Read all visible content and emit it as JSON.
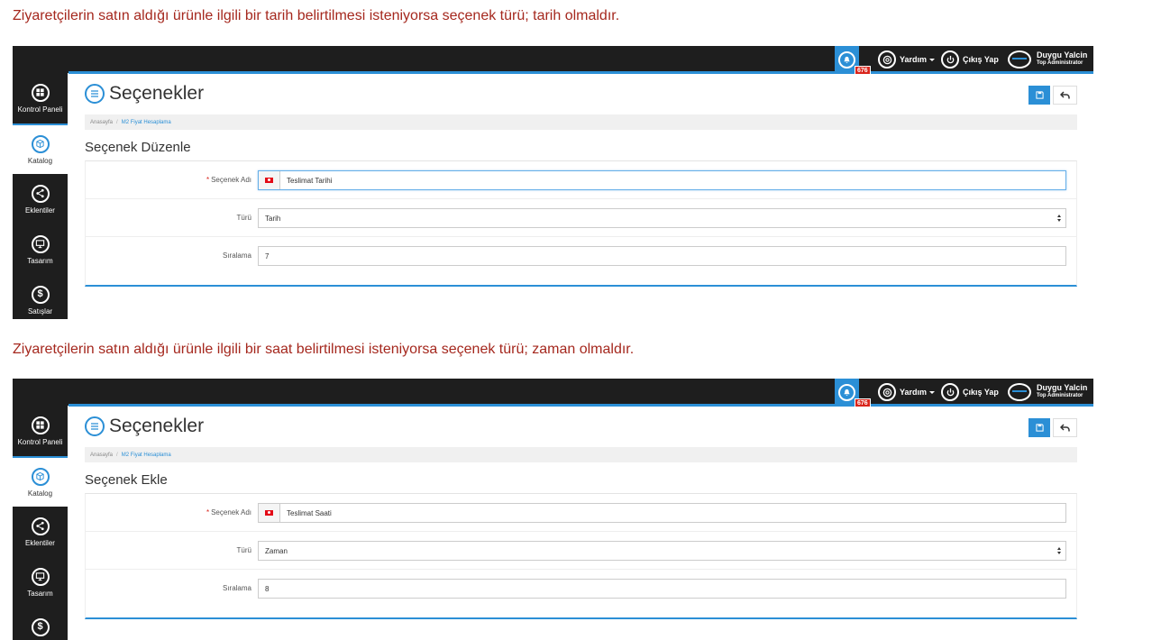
{
  "captions": [
    "Ziyaretçilerin satın aldığı ürünle ilgili bir tarih belirtilmesi isteniyorsa seçenek türü; tarih olmaldır.",
    "Ziyaretçilerin satın aldığı ürünle ilgili bir saat belirtilmesi isteniyorsa seçenek türü; zaman olmaldır."
  ],
  "topbar": {
    "notification_count": "676",
    "help_label": "Yardım",
    "logout_label": "Çıkış Yap",
    "user_name": "Duygu Yalcin",
    "user_role": "Top Administrator"
  },
  "sidebar": {
    "items": [
      {
        "label": "Kontrol Paneli",
        "icon": "grid-icon"
      },
      {
        "label": "Katalog",
        "icon": "box-icon"
      },
      {
        "label": "Eklentiler",
        "icon": "share-icon"
      },
      {
        "label": "Tasarım",
        "icon": "monitor-icon"
      },
      {
        "label": "Satışlar",
        "icon": "dollar-icon"
      }
    ]
  },
  "colors": {
    "accent": "#2b8fd6",
    "dark": "#1e1e1e",
    "caption": "#a5281e",
    "badge": "#d9251c"
  },
  "screens": [
    {
      "page_title": "Seçenekler",
      "breadcrumb": {
        "home": "Anasayfa",
        "current": "M2 Fiyat Hesaplama"
      },
      "section_title": "Seçenek Düzenle",
      "form": {
        "name_label": "Seçenek Adı",
        "name_value": "Teslimat Tarihi",
        "type_label": "Türü",
        "type_value": "Tarih",
        "order_label": "Sıralama",
        "order_value": "7"
      }
    },
    {
      "page_title": "Seçenekler",
      "breadcrumb": {
        "home": "Anasayfa",
        "current": "M2 Fiyat Hesaplama"
      },
      "section_title": "Seçenek Ekle",
      "form": {
        "name_label": "Seçenek Adı",
        "name_value": "Teslimat Saati",
        "type_label": "Türü",
        "type_value": "Zaman",
        "order_label": "Sıralama",
        "order_value": "8"
      }
    }
  ]
}
